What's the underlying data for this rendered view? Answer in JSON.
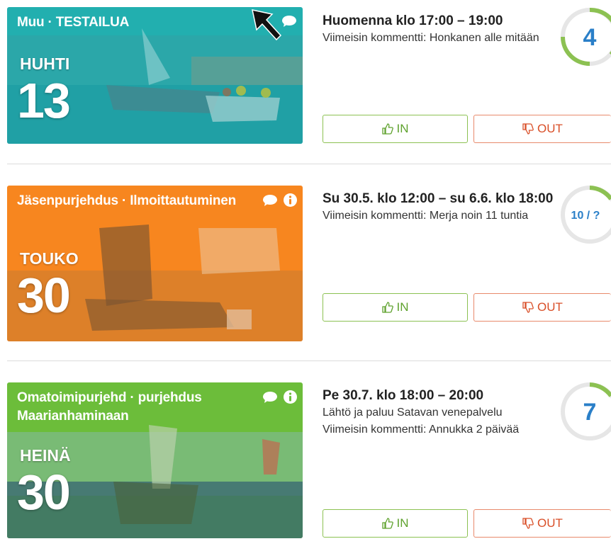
{
  "events": [
    {
      "category": "Muu · TESTAILUA",
      "month": "HUHTI",
      "day": "13",
      "color": "#22b0b0",
      "icons": [
        "comment-icon"
      ],
      "title": "Huomenna klo 17:00 – 19:00",
      "lines": [
        "Viimeisin kommentti: Honkanen alle mitään"
      ],
      "count": "4",
      "progress": 0.42,
      "in_label": "IN",
      "out_label": "OUT"
    },
    {
      "category": "Jäsenpurjehdus · Ilmoittautuminen",
      "month": "TOUKO",
      "day": "30",
      "color": "#f7861f",
      "icons": [
        "comment-icon",
        "info-icon"
      ],
      "title": "Su 30.5. klo 12:00 – su 6.6. klo 18:00",
      "lines": [
        "Viimeisin kommentti: Merja noin 11 tuntia"
      ],
      "count": "10 / ?",
      "progress": 0.22,
      "in_label": "IN",
      "out_label": "OUT"
    },
    {
      "category": "Omatoimipurjehd · purjehdus Maarianhaminaan",
      "month": "HEINÄ",
      "day": "30",
      "color": "#6cbe3a",
      "icons": [
        "comment-icon",
        "info-icon"
      ],
      "title": "Pe 30.7. klo 18:00 – 20:00",
      "lines": [
        "Lähtö ja paluu Satavan venepalvelu",
        "Viimeisin kommentti: Annukka 2 päivää"
      ],
      "count": "7",
      "progress": 0.22,
      "in_label": "IN",
      "out_label": "OUT"
    }
  ]
}
